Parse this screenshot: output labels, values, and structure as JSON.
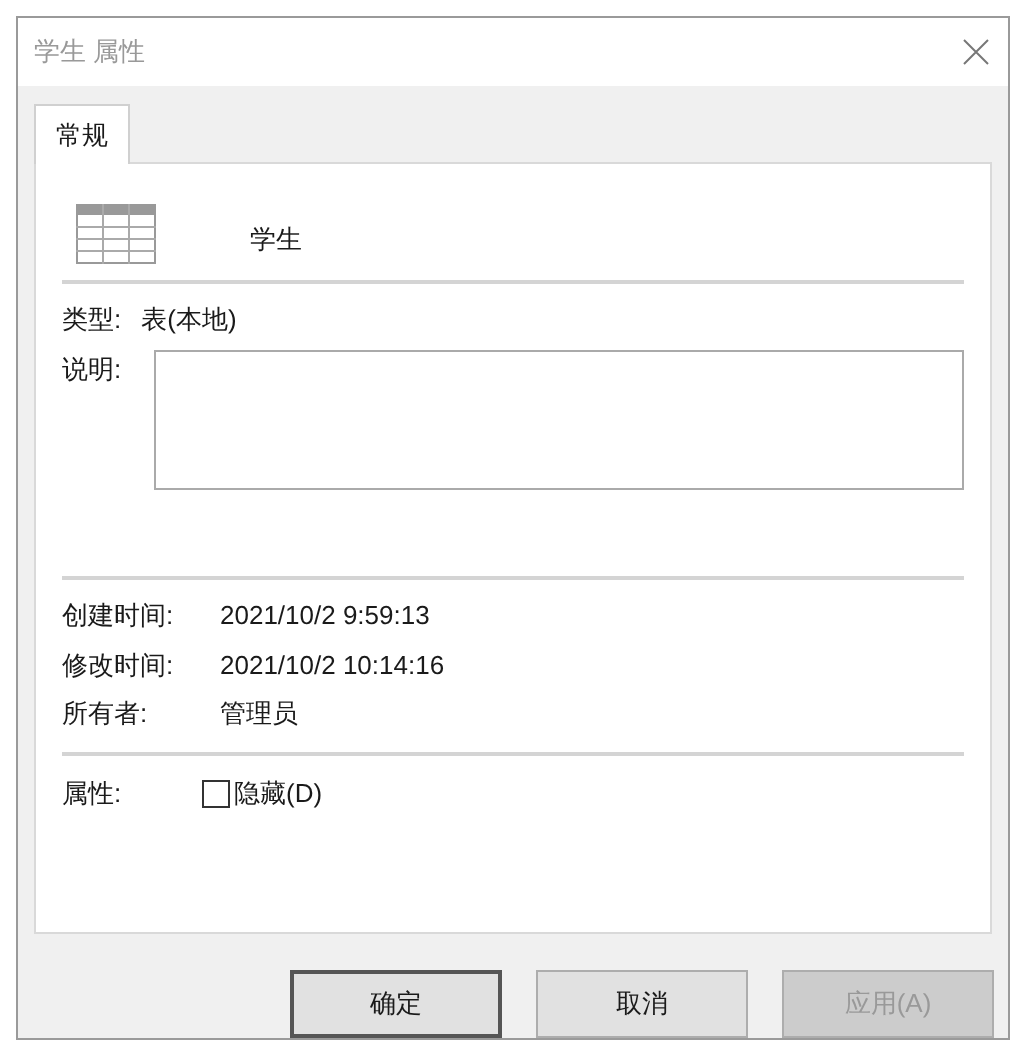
{
  "window": {
    "title": "学生 属性"
  },
  "tabs": [
    {
      "label": "常规",
      "selected": true
    }
  ],
  "object": {
    "name": "学生"
  },
  "type": {
    "label": "类型:",
    "value": "表(本地)"
  },
  "description": {
    "label": "说明:"
  },
  "info": [
    {
      "label": "创建时间:",
      "value": "2021/10/2 9:59:13"
    },
    {
      "label": "修改时间:",
      "value": "2021/10/2 10:14:16"
    },
    {
      "label": "所有者:",
      "value": "管理员"
    }
  ],
  "attributes": {
    "label": "属性:",
    "options": [
      {
        "label": "隐藏(D)",
        "checked": false
      }
    ]
  },
  "buttons": [
    {
      "label": "确定",
      "default": true,
      "disabled": false
    },
    {
      "label": "取消",
      "default": false,
      "disabled": false
    },
    {
      "label": "应用(A)",
      "default": false,
      "disabled": true
    }
  ]
}
